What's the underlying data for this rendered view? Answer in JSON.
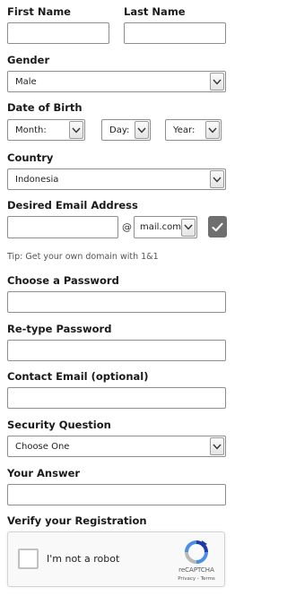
{
  "labels": {
    "first_name": "First Name",
    "last_name": "Last Name",
    "gender": "Gender",
    "dob": "Date of Birth",
    "country": "Country",
    "email": "Desired Email Address",
    "password": "Choose a Password",
    "retype": "Re-type Password",
    "contact": "Contact Email (optional)",
    "question": "Security Question",
    "answer": "Your Answer",
    "verify": "Verify your Registration"
  },
  "selects": {
    "gender": "Male",
    "month": "Month:",
    "day": "Day:",
    "year": "Year:",
    "country": "Indonesia",
    "domain": "mail.com",
    "question": "Choose One"
  },
  "email": {
    "at": "@",
    "tip": "Tip: Get your own domain with 1&1"
  },
  "captcha": {
    "label": "I'm not a robot",
    "brand": "reCAPTCHA",
    "links": "Privacy - Terms"
  },
  "colors": {
    "border": "#8e8e8e",
    "check_button": "#6f6f6f",
    "recaptcha_blue": "#1c3aa9",
    "recaptcha_light": "#4a90e2"
  }
}
